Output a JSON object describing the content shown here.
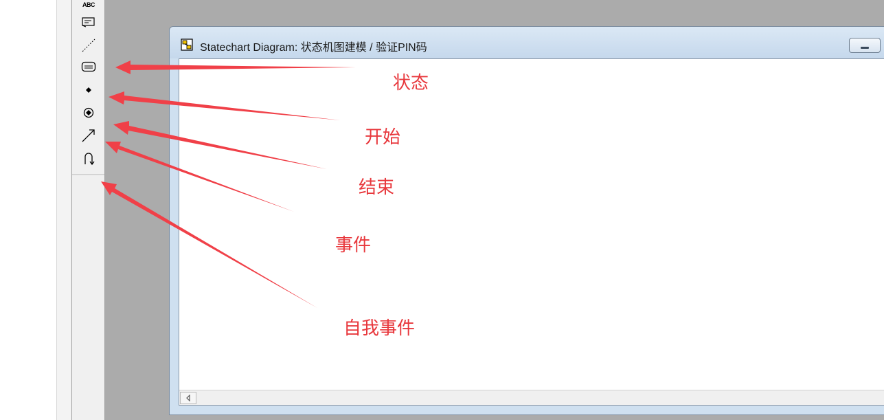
{
  "window": {
    "title": "Statechart Diagram: 状态机图建模 / 验证PIN码"
  },
  "toolbar": {
    "tools": [
      {
        "name": "text-tool",
        "label": "ABC"
      },
      {
        "name": "note-tool"
      },
      {
        "name": "anchor-note-tool"
      },
      {
        "name": "state-tool"
      },
      {
        "name": "start-state-tool"
      },
      {
        "name": "end-state-tool"
      },
      {
        "name": "transition-tool"
      },
      {
        "name": "self-transition-tool"
      }
    ]
  },
  "annotations": {
    "state": "状态",
    "start": "开始",
    "end": "结束",
    "event": "事件",
    "self_event": "自我事件"
  },
  "colors": {
    "annotation": "#e8383d",
    "mdi_background": "#ababab",
    "titlebar": "#c5d8ec"
  }
}
